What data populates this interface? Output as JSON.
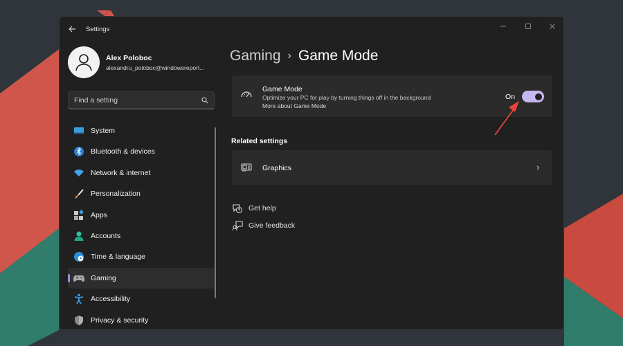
{
  "colors": {
    "desktop_bg": "#2f353b",
    "shape_red": "#d0554a",
    "shape_green": "#2f7d6a",
    "window_bg": "#202020",
    "card_bg": "#2b2b2b",
    "accent": "#c5b8ee",
    "annotation_arrow": "#e8453c"
  },
  "window": {
    "title": "Settings",
    "controls": [
      "minimize-icon",
      "maximize-icon",
      "close-icon"
    ]
  },
  "profile": {
    "name": "Alex Poloboc",
    "email": "alexandru_poloboc@windowsreport..."
  },
  "search": {
    "placeholder": "Find a setting",
    "icon": "search-icon"
  },
  "sidebar": {
    "items": [
      {
        "label": "System",
        "icon": "system-display-icon",
        "active": false
      },
      {
        "label": "Bluetooth & devices",
        "icon": "bluetooth-icon",
        "active": false
      },
      {
        "label": "Network & internet",
        "icon": "wifi-icon",
        "active": false
      },
      {
        "label": "Personalization",
        "icon": "brush-icon",
        "active": false
      },
      {
        "label": "Apps",
        "icon": "apps-icon",
        "active": false
      },
      {
        "label": "Accounts",
        "icon": "accounts-icon",
        "active": false
      },
      {
        "label": "Time & language",
        "icon": "globe-clock-icon",
        "active": false
      },
      {
        "label": "Gaming",
        "icon": "gamepad-icon",
        "active": true
      },
      {
        "label": "Accessibility",
        "icon": "accessibility-icon",
        "active": false
      },
      {
        "label": "Privacy & security",
        "icon": "shield-icon",
        "active": false
      }
    ]
  },
  "breadcrumb": {
    "parent": "Gaming",
    "separator": "›",
    "current": "Game Mode"
  },
  "game_mode": {
    "title": "Game Mode",
    "description": "Optimize your PC for play by turning things off in the background",
    "link": "More about Game Mode",
    "toggle_state": "On",
    "toggle_on": true,
    "icon": "game-mode-gauge-icon"
  },
  "related": {
    "title": "Related settings",
    "items": [
      {
        "label": "Graphics",
        "icon": "graphics-card-icon",
        "chevron": "›"
      }
    ]
  },
  "help": {
    "get_help": "Get help",
    "give_feedback": "Give feedback"
  }
}
